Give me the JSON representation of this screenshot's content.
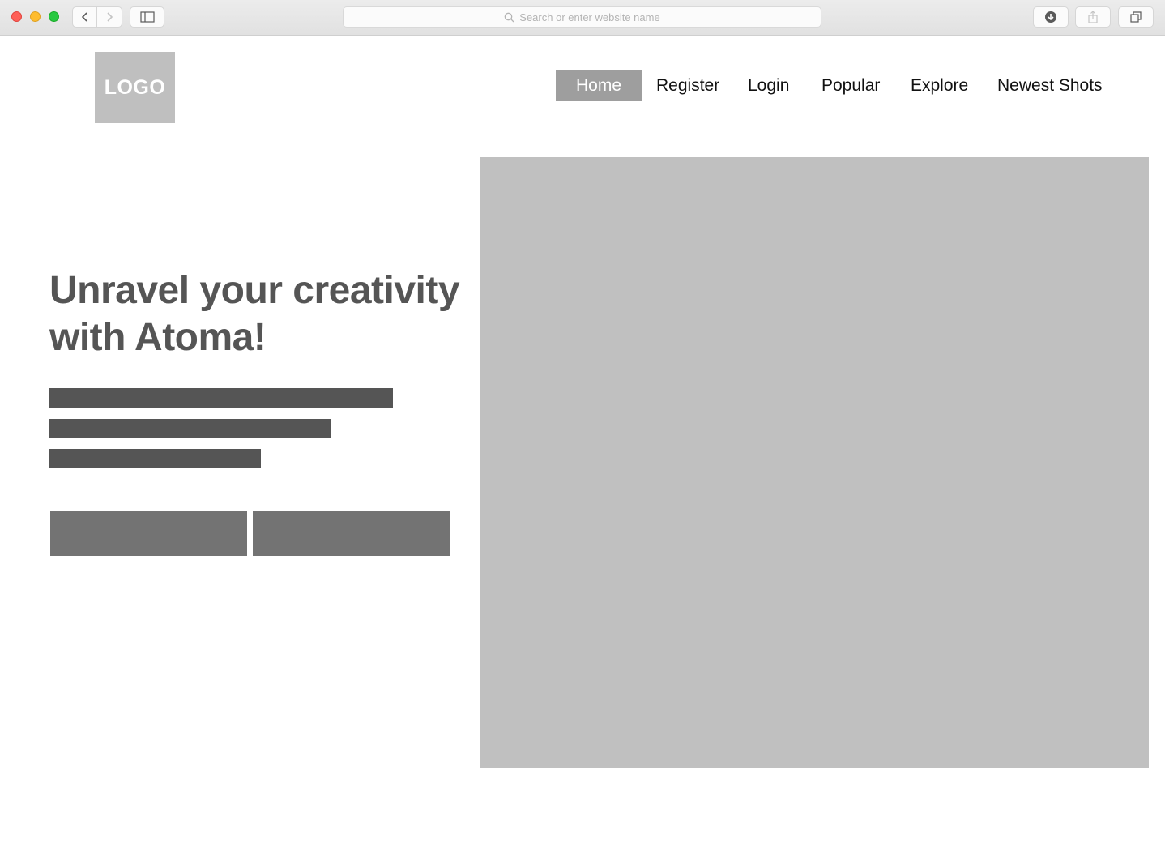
{
  "browser": {
    "address_placeholder": "Search or enter website name",
    "icons": {
      "back": "chevron-left-icon",
      "forward": "chevron-right-icon",
      "sidebar": "sidebar-icon",
      "search": "search-icon",
      "download": "download-icon",
      "share": "share-icon",
      "tabs": "tabs-icon"
    }
  },
  "header": {
    "logo_text": "LOGO",
    "nav": {
      "home": "Home",
      "register": "Register",
      "login": "Login",
      "popular": "Popular",
      "explore": "Explore",
      "newest_shots": "Newest Shots"
    },
    "active_nav": "home"
  },
  "hero": {
    "headline_line1": "Unravel your creativity",
    "headline_line2": "with Atoma!",
    "text_placeholder_lines": 3,
    "buttons": 2
  },
  "colors": {
    "logo_bg": "#bfbfbf",
    "nav_active_bg": "#9e9e9e",
    "headline": "#555555",
    "text_placeholder": "#555555",
    "button": "#737373",
    "image_placeholder": "#c0c0c0"
  }
}
